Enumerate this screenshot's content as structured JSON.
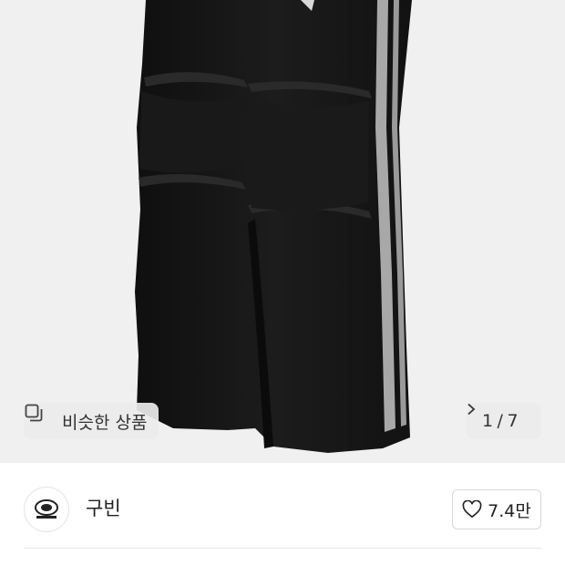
{
  "product_image": {
    "similar_button_label": "비슷한 상품",
    "current_image": "1",
    "total_images": "7",
    "counter_separator": "/"
  },
  "seller": {
    "shop_name": "구빈",
    "like_count": "7.4만"
  },
  "icons": {
    "similar": "similar-items-icon",
    "pager": "chevron-right-icon",
    "like": "heart-outline-icon",
    "avatar": "shop-logo-icon"
  },
  "colors": {
    "image_background": "#f0f0f0",
    "pants": "#151515",
    "side_stripe": "#a8a8a8",
    "pill_background": "#ececec",
    "text_primary": "#222222"
  }
}
